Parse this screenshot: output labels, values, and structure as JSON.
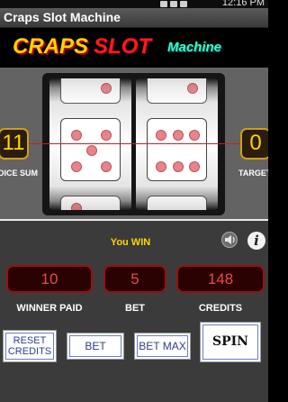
{
  "app": {
    "title": "Craps Slot Machine"
  },
  "status_bar": {
    "time": "12:16 PM"
  },
  "logo": {
    "part1": "CRAPS",
    "part2": "SLOT",
    "part3": "Machine"
  },
  "reels": [
    {
      "name": "left",
      "top_partial": 2,
      "center": 5,
      "bottom_partial": 3
    },
    {
      "name": "right",
      "top_partial": 2,
      "center": 6,
      "bottom_partial": 1
    }
  ],
  "dice_sum": {
    "value": "11",
    "label": "DICE SUM"
  },
  "target": {
    "value": "0",
    "label": "TARGET"
  },
  "message": "You WIN",
  "readouts": {
    "winner_paid": {
      "value": "10",
      "label": "WINNER PAID"
    },
    "bet": {
      "value": "5",
      "label": "BET"
    },
    "credits": {
      "value": "148",
      "label": "CREDITS"
    }
  },
  "buttons": {
    "reset_line1": "RESET",
    "reset_line2": "CREDITS",
    "bet": "BET",
    "bet_max": "BET MAX",
    "spin": "SPIN"
  },
  "icons": {
    "sound": "speaker-icon",
    "info": "info-icon"
  },
  "colors": {
    "accent_gold": "#ffd400",
    "readout_red": "#e84a4a",
    "win_line": "#d11c1c"
  }
}
